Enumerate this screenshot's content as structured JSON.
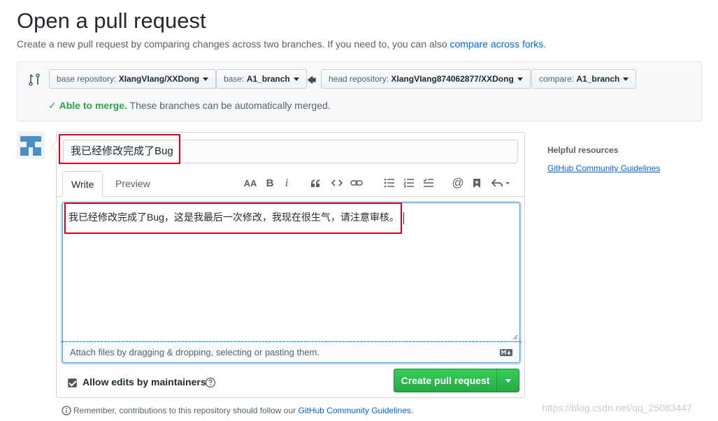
{
  "page": {
    "title": "Open a pull request",
    "subtitle_prefix": "Create a new pull request by comparing changes across two branches. If you need to, you can also ",
    "subtitle_link": "compare across forks",
    "subtitle_suffix": "."
  },
  "range": {
    "base_repository_label": "base repository: ",
    "base_repository_value": "XIangVIang/XXDong",
    "base_branch_label": "base: ",
    "base_branch_value": "A1_branch",
    "head_repository_label": "head repository: ",
    "head_repository_value": "XIangVIang874062877/XXDong",
    "compare_label": "compare: ",
    "compare_value": "A1_branch",
    "merge_check": "✓",
    "merge_status_strong": "Able to merge.",
    "merge_status_text": " These branches can be automatically merged."
  },
  "composer": {
    "title_value": "我已经修改完成了Bug",
    "tab_write": "Write",
    "tab_preview": "Preview",
    "toolbar": {
      "header": "AA",
      "bold": "B",
      "italic": "i"
    },
    "body_value": "我已经修改完成了Bug，这是我最后一次修改，我现在很生气，请注意审核。",
    "attach_text": "Attach files by dragging & dropping, selecting or pasting them.",
    "allow_edits_label": "Allow edits by maintainers",
    "create_button": "Create pull request"
  },
  "footer": {
    "note_prefix": "Remember, contributions to this repository should follow our ",
    "note_link": "GitHub Community Guidelines",
    "note_suffix": "."
  },
  "sidebar": {
    "title": "Helpful resources",
    "link": "GitHub Community Guidelines"
  },
  "watermark": "https://blog.csdn.net/qq_25083447",
  "colors": {
    "link": "#0366d6",
    "success": "#28a745",
    "annotation": "#d0021b"
  }
}
